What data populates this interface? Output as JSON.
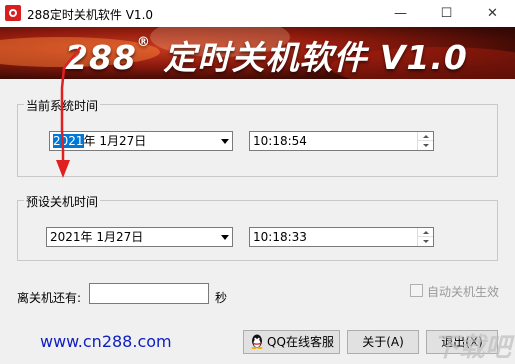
{
  "window": {
    "title": "288定时关机软件 V1.0",
    "minimize": "—",
    "maximize": "☐",
    "close": "✕"
  },
  "banner": {
    "brand": "288",
    "reg": "®",
    "title": "定时关机软件 V1.0"
  },
  "current_time": {
    "label": "当前系统时间",
    "date_year": "2021",
    "date_rest": "年  1月27日",
    "time": "10:18:54"
  },
  "shutdown_time": {
    "label": "预设关机时间",
    "date": "2021年  1月27日",
    "time": "10:18:33"
  },
  "remaining": {
    "label": "离关机还有:",
    "value": "",
    "unit": "秒"
  },
  "auto_shutdown": {
    "label": "自动关机生效",
    "checked": false
  },
  "footer": {
    "website": "www.cn288.com",
    "qq_button": "QQ在线客服",
    "about_button": "关于(A)",
    "exit_button": "退出(X)",
    "watermark": "下载吧"
  },
  "colors": {
    "accent_link": "#1020c0",
    "annotation_arrow": "#e02020",
    "selection": "#0078d7"
  }
}
